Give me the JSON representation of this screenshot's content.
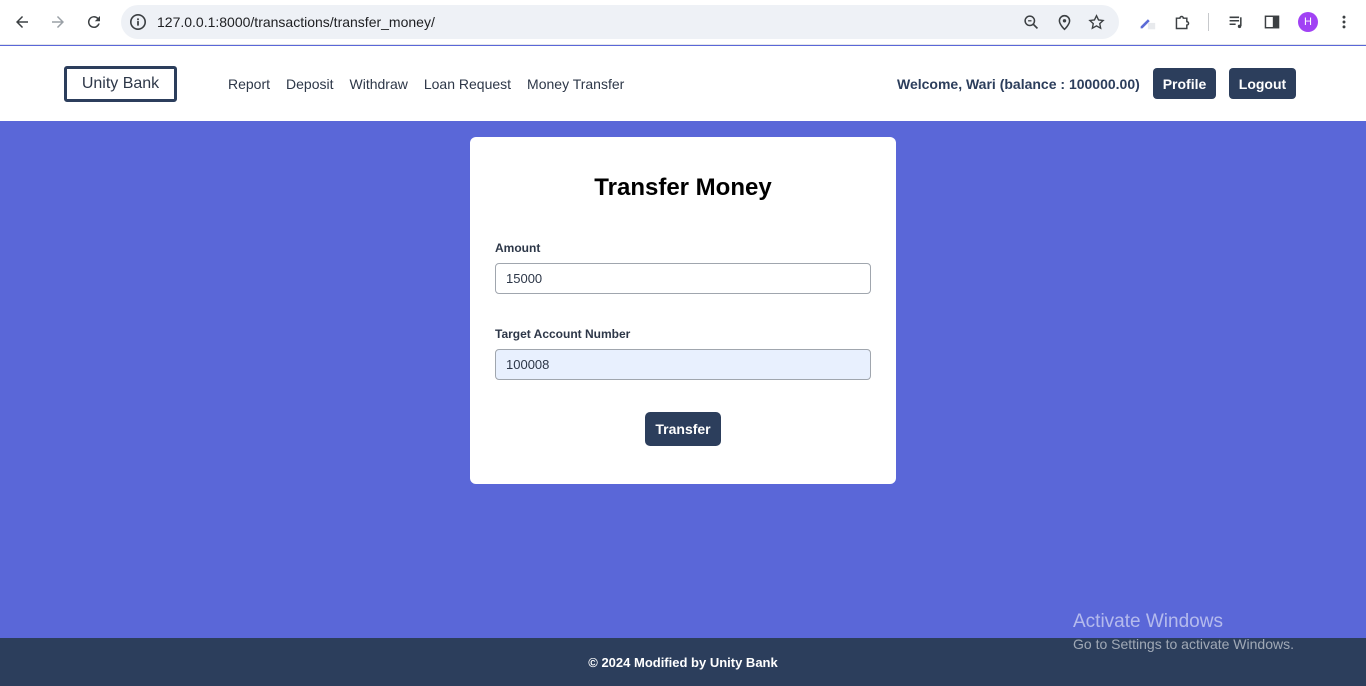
{
  "browser": {
    "url": "127.0.0.1:8000/transactions/transfer_money/",
    "avatar_letter": "H",
    "icons": [
      "back-icon",
      "forward-icon",
      "reload-icon",
      "site-info-icon",
      "zoom-icon",
      "location-icon",
      "star-icon",
      "extension-puzzle-icon",
      "media-queue-icon",
      "side-panel-icon",
      "kebab-menu-icon"
    ]
  },
  "header": {
    "brand": "Unity Bank",
    "nav": [
      "Report",
      "Deposit",
      "Withdraw",
      "Loan Request",
      "Money Transfer"
    ],
    "welcome": "Welcome, Wari (balance : 100000.00)",
    "profile_label": "Profile",
    "logout_label": "Logout"
  },
  "form": {
    "title": "Transfer Money",
    "amount_label": "Amount",
    "amount_value": "15000",
    "account_label": "Target Account Number",
    "account_value": "100008",
    "submit_label": "Transfer"
  },
  "footer": {
    "text": "© 2024 Modified by Unity Bank"
  },
  "watermark": {
    "line1": "Activate Windows",
    "line2": "Go to Settings to activate Windows."
  },
  "colors": {
    "background": "#5a67d8",
    "primary": "#2c3e5c",
    "card": "#ffffff"
  }
}
